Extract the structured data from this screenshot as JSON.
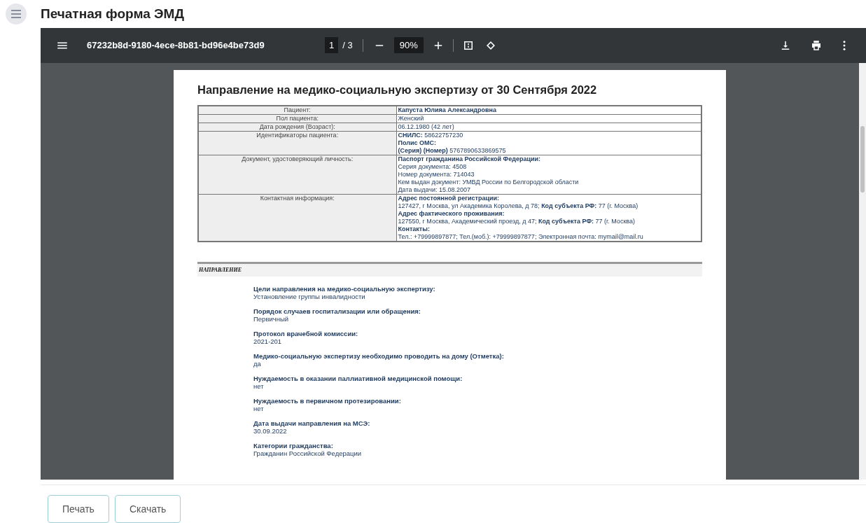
{
  "header": {
    "title": "Печатная форма ЭМД"
  },
  "viewer": {
    "file_name": "67232b8d-9180-4ece-8b81-bd96e4be73d9",
    "page_current": "1",
    "page_total": "/ 3",
    "zoom": "90%"
  },
  "document": {
    "title": "Направление на медико-социальную экспертизу от 30 Сентября 2022",
    "rows": [
      {
        "label": "Пациент:",
        "lines": [
          "**Капуста Юлияа Александровна**"
        ]
      },
      {
        "label": "Пол пациента:",
        "lines": [
          "Женский"
        ]
      },
      {
        "label": "Дата рождения (Возраст):",
        "lines": [
          "06.12.1980 (42 лет)"
        ]
      },
      {
        "label": "Идентификаторы пациента:",
        "lines": [
          "**СНИЛС:** 58622757230",
          "**Полис ОМС:**",
          "**(Серия) (Номер)** 5767890633869575"
        ]
      },
      {
        "label": "Документ, удостоверяющий личность:",
        "lines": [
          "**Паспорт гражданина Российской Федерации:**",
          "Серия документа: 4508",
          "Номер документа: 714043",
          "Кем выдан документ: УМВД России по Белгородской области",
          "Дата выдачи: 15.08.2007"
        ]
      },
      {
        "label": "Контактная информация:",
        "lines": [
          "**Адрес постоянной регистрации:**",
          "127427, г Москва, ул Академика Королева, д 78; **Код субъекта РФ:** 77 (г. Москва)",
          "**Адрес фактического проживания:**",
          "127550, г Москва, Академический проезд, д 47; **Код субъекта РФ:** 77 (г. Москва)",
          "**Контакты:**",
          "Тел.: +79999897877; Тел.(моб.): +79999897877; Электронная почта: mymail@mail.ru"
        ]
      }
    ],
    "section_title": "НАПРАВЛЕНИЕ",
    "fields": [
      {
        "label": "Цели направления на медико-социальную экспертизу:",
        "value": "Установление группы инвалидности"
      },
      {
        "label": "Порядок случаев госпитализации или обращения:",
        "value": "Первичный"
      },
      {
        "label": "Протокол врачебной комиссии:",
        "value": "2021-201"
      },
      {
        "label": "Медико-социальную экспертизу необходимо проводить на дому (Отметка):",
        "value": "да"
      },
      {
        "label": "Нуждаемость в оказании паллиативной медицинской помощи:",
        "value": "нет"
      },
      {
        "label": "Нуждаемость в первичном протезировании:",
        "value": "нет"
      },
      {
        "label": "Дата выдачи направления на МСЭ:",
        "value": "30.09.2022"
      },
      {
        "label": "Категории гражданства:",
        "value": "Гражданин Российской Федерации"
      }
    ]
  },
  "buttons": [
    "Печать",
    "Скачать"
  ]
}
